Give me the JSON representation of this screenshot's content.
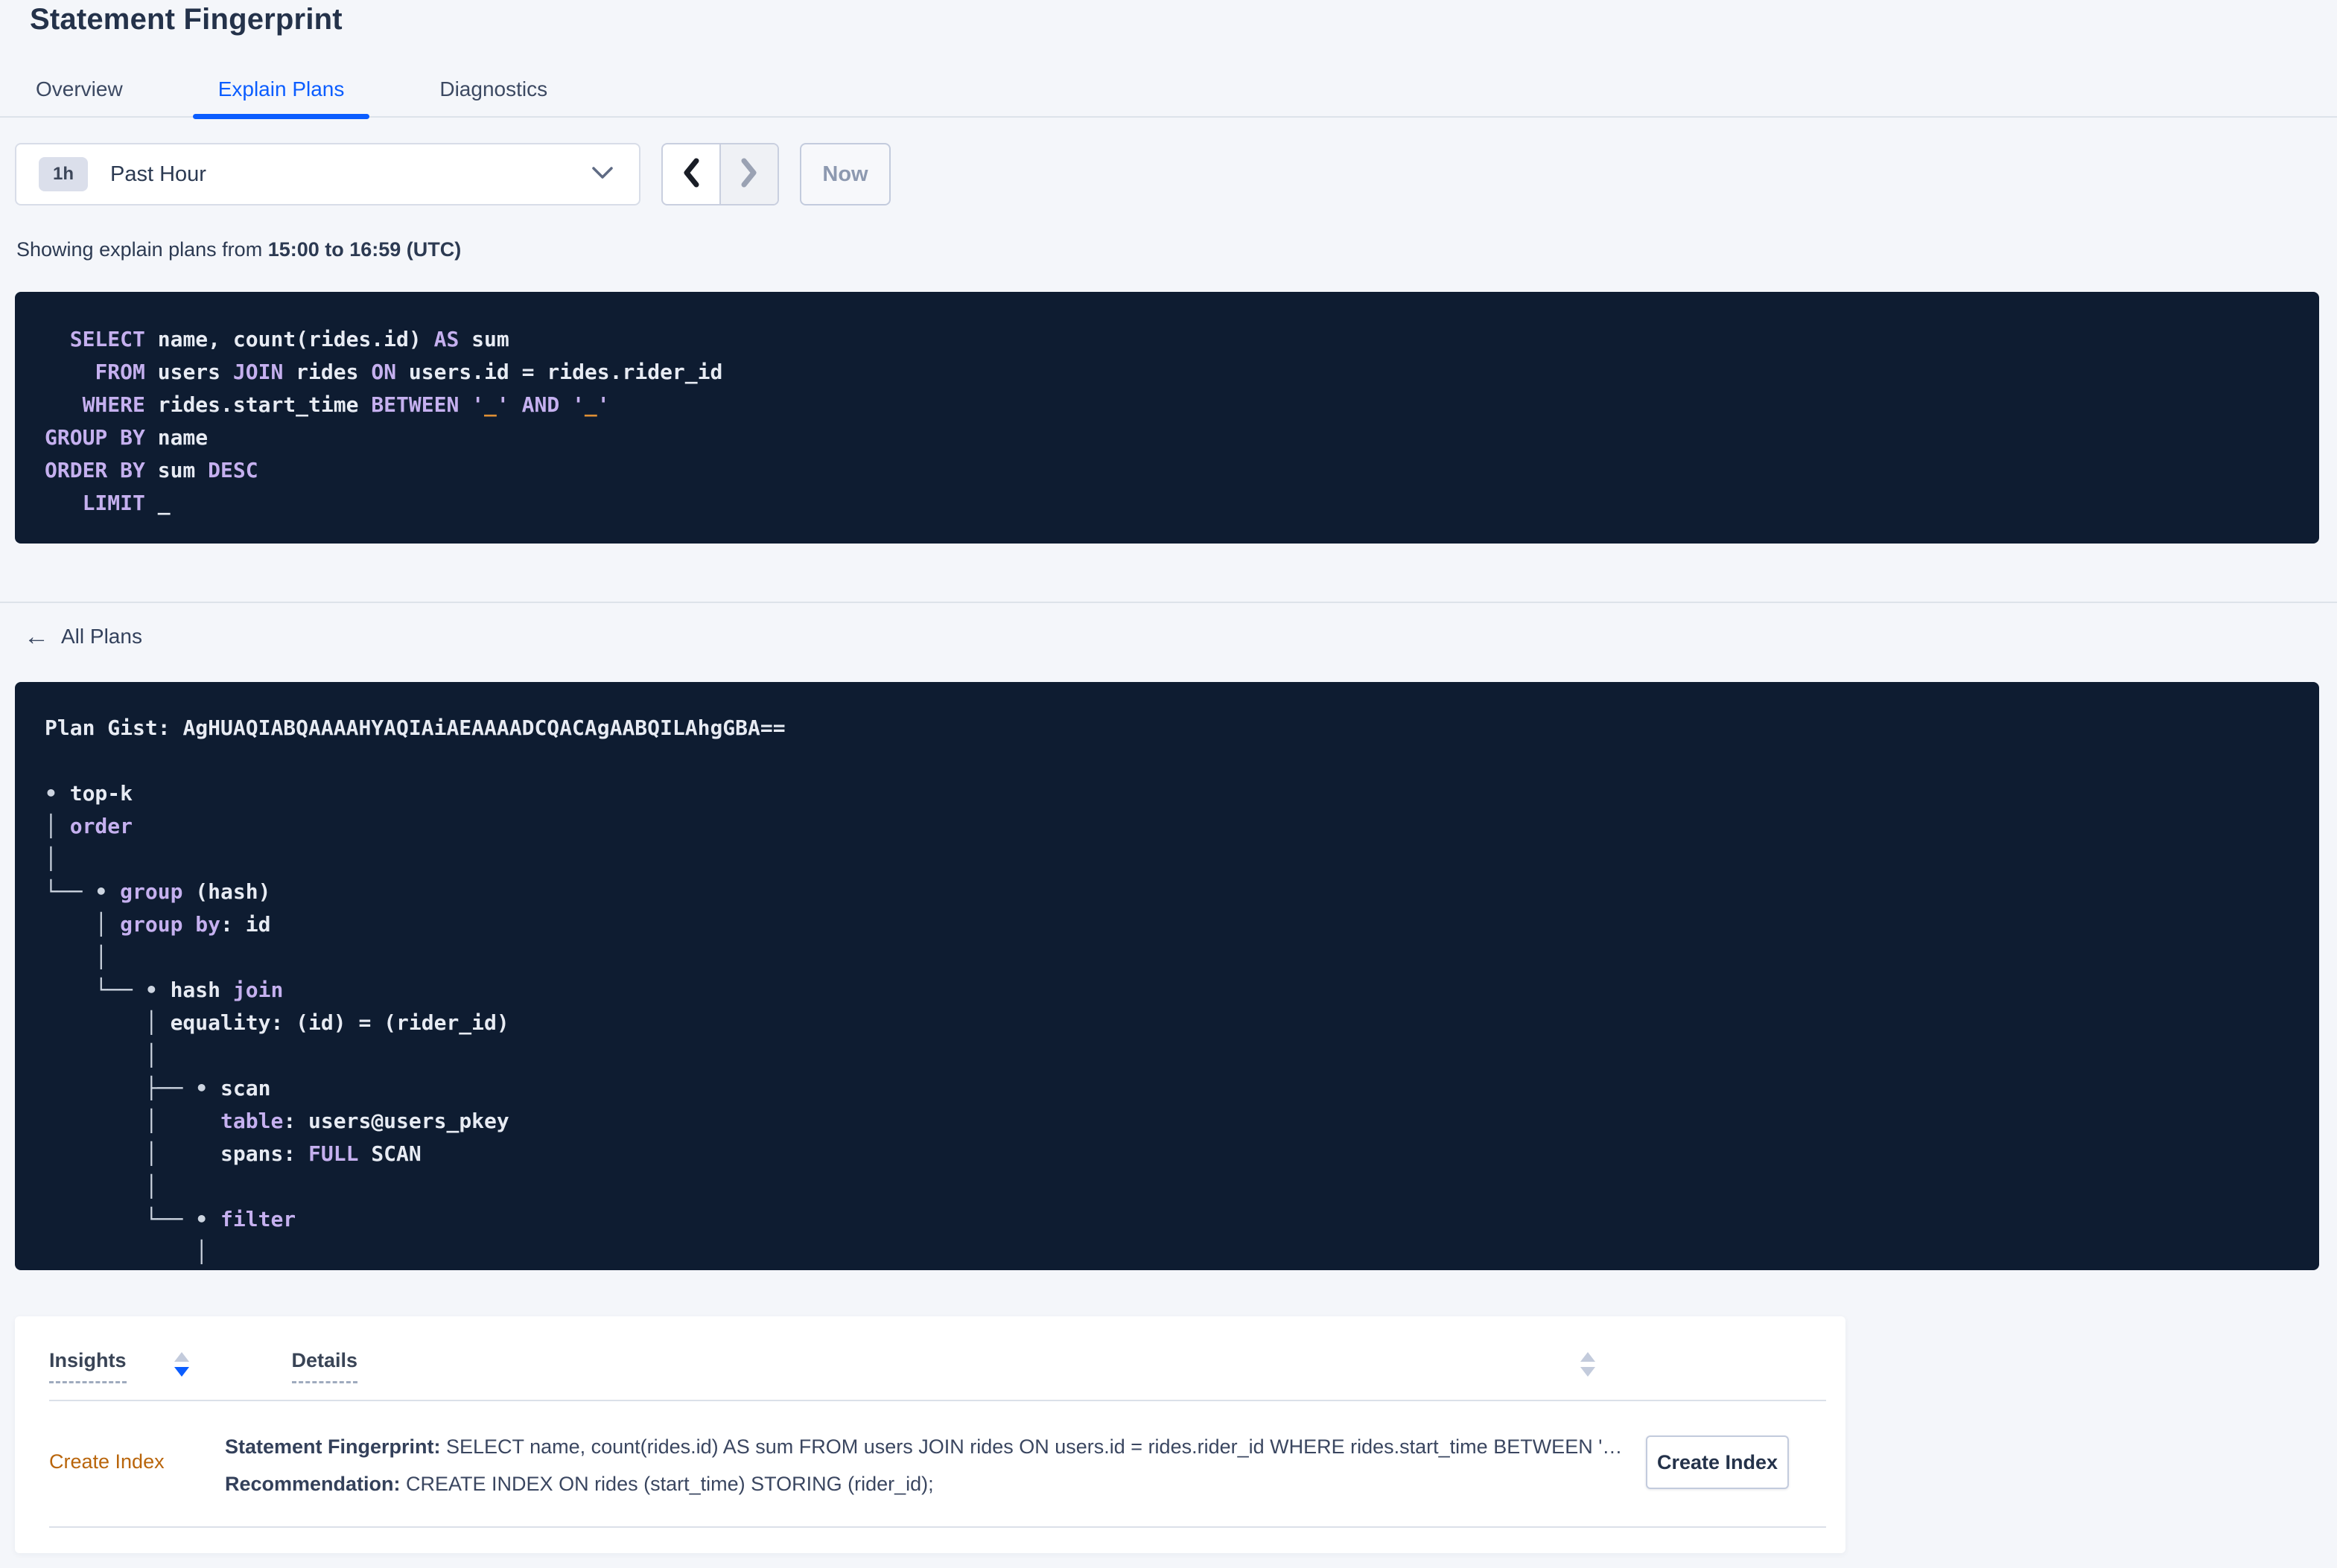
{
  "page": {
    "title": "Statement Fingerprint"
  },
  "tabs": [
    {
      "label": "Overview",
      "active": false
    },
    {
      "label": "Explain Plans",
      "active": true
    },
    {
      "label": "Diagnostics",
      "active": false
    }
  ],
  "toolbar": {
    "range_badge": "1h",
    "range_label": "Past Hour",
    "now_label": "Now"
  },
  "subtitle": {
    "prefix": "Showing explain plans from ",
    "range": "15:00 to 16:59 (UTC)"
  },
  "sql": {
    "lines": [
      [
        {
          "t": "  "
        },
        {
          "t": "SELECT",
          "c": "k"
        },
        {
          "t": " name, count(rides.id) "
        },
        {
          "t": "AS",
          "c": "k"
        },
        {
          "t": " sum"
        }
      ],
      [
        {
          "t": "    "
        },
        {
          "t": "FROM",
          "c": "k"
        },
        {
          "t": " users "
        },
        {
          "t": "JOIN",
          "c": "k"
        },
        {
          "t": " rides "
        },
        {
          "t": "ON",
          "c": "k"
        },
        {
          "t": " users.id = rides.rider_id"
        }
      ],
      [
        {
          "t": "   "
        },
        {
          "t": "WHERE",
          "c": "k"
        },
        {
          "t": " rides.start_time "
        },
        {
          "t": "BETWEEN",
          "c": "k"
        },
        {
          "t": " "
        },
        {
          "t": "'",
          "c": "k"
        },
        {
          "t": "_",
          "c": "o"
        },
        {
          "t": "'",
          "c": "k"
        },
        {
          "t": " "
        },
        {
          "t": "AND",
          "c": "k"
        },
        {
          "t": " "
        },
        {
          "t": "'",
          "c": "k"
        },
        {
          "t": "_",
          "c": "o"
        },
        {
          "t": "'",
          "c": "k"
        }
      ],
      [
        {
          "t": "GROUP BY",
          "c": "k"
        },
        {
          "t": " name"
        }
      ],
      [
        {
          "t": "ORDER BY",
          "c": "k"
        },
        {
          "t": " sum "
        },
        {
          "t": "DESC",
          "c": "k"
        }
      ],
      [
        {
          "t": "   "
        },
        {
          "t": "LIMIT",
          "c": "k"
        },
        {
          "t": " _"
        }
      ]
    ]
  },
  "plans": {
    "back_label": "All Plans",
    "gist_label": "Plan Gist: ",
    "gist_value": "AgHUAQIABQAAAAHYAQIAiAEAAAADCQACAgAABQILAhgGBA==",
    "tree": [
      [
        {
          "t": "• ",
          "c": "b"
        },
        {
          "t": "top-k"
        }
      ],
      [
        {
          "t": "│ ",
          "c": "b"
        },
        {
          "t": "order",
          "c": "k"
        }
      ],
      [
        {
          "t": "│",
          "c": "b"
        }
      ],
      [
        {
          "t": "└── • ",
          "c": "b"
        },
        {
          "t": "group",
          "c": "k"
        },
        {
          "t": " (hash)"
        }
      ],
      [
        {
          "t": "    │ ",
          "c": "b"
        },
        {
          "t": "group by",
          "c": "k"
        },
        {
          "t": ": id"
        }
      ],
      [
        {
          "t": "    │",
          "c": "b"
        }
      ],
      [
        {
          "t": "    └── • ",
          "c": "b"
        },
        {
          "t": "hash "
        },
        {
          "t": "join",
          "c": "k"
        }
      ],
      [
        {
          "t": "        │ ",
          "c": "b"
        },
        {
          "t": "equality: (id) = (rider_id)"
        }
      ],
      [
        {
          "t": "        │",
          "c": "b"
        }
      ],
      [
        {
          "t": "        ├── • ",
          "c": "b"
        },
        {
          "t": "scan"
        }
      ],
      [
        {
          "t": "        │     ",
          "c": "b"
        },
        {
          "t": "table",
          "c": "k"
        },
        {
          "t": ": users@users_pkey"
        }
      ],
      [
        {
          "t": "        │     ",
          "c": "b"
        },
        {
          "t": "spans: "
        },
        {
          "t": "FULL",
          "c": "k"
        },
        {
          "t": " SCAN"
        }
      ],
      [
        {
          "t": "        │",
          "c": "b"
        }
      ],
      [
        {
          "t": "        └── • ",
          "c": "b"
        },
        {
          "t": "filter",
          "c": "k"
        }
      ],
      [
        {
          "t": "            │",
          "c": "b"
        }
      ]
    ]
  },
  "insights": {
    "col_insights": "Insights",
    "col_details": "Details",
    "rows": [
      {
        "insight_type": "Create Index",
        "fingerprint_label": "Statement Fingerprint:",
        "fingerprint_text": " SELECT name, count(rides.id) AS sum FROM users JOIN rides ON users.id = rides.rider_id WHERE rides.start_time BETWEEN '_…",
        "recommendation_label": "Recommendation:",
        "recommendation_text": " CREATE INDEX ON rides (start_time) STORING (rider_id);",
        "action_label": "Create Index"
      }
    ]
  },
  "colors": {
    "accent_blue": "#0b5dff",
    "code_background": "#0e1c31",
    "code_keyword": "#c5b0ef",
    "code_literal": "#df8f35",
    "insight_orange": "#b9650b"
  }
}
